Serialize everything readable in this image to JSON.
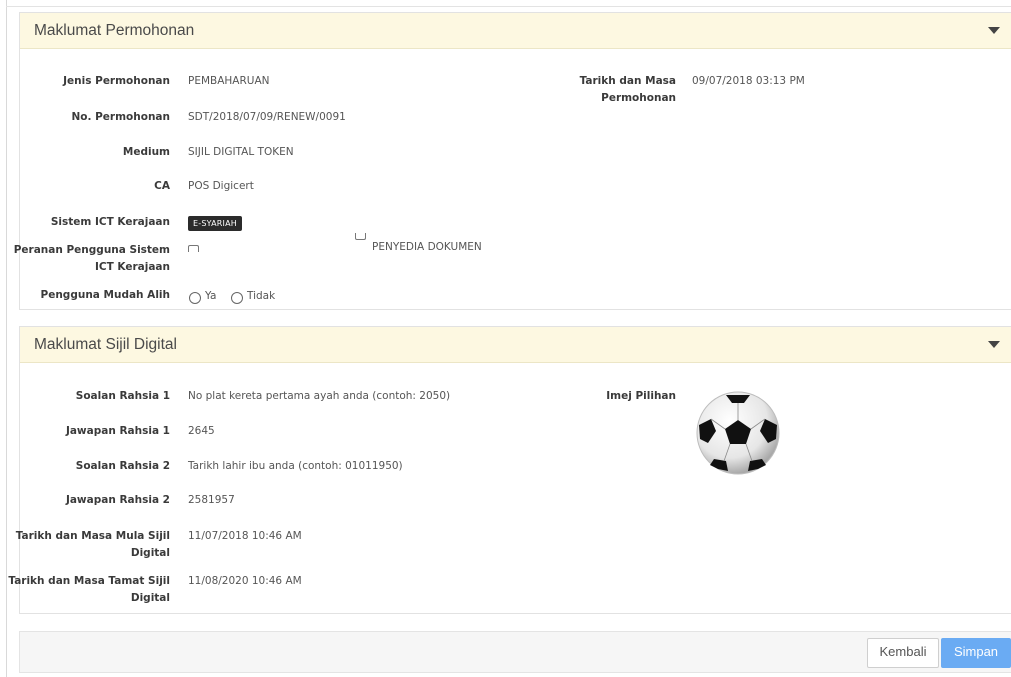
{
  "section1": {
    "title": "Maklumat Permohonan",
    "fields": {
      "jenis_label": "Jenis Permohonan",
      "jenis_value": "PEMBAHARUAN",
      "no_label": "No. Permohonan",
      "no_value": "SDT/2018/07/09/RENEW/0091",
      "medium_label": "Medium",
      "medium_value": "SIJIL DIGITAL TOKEN",
      "ca_label": "CA",
      "ca_value": "POS Digicert",
      "sistem_label": "Sistem ICT Kerajaan",
      "sistem_badge": "E-SYARIAH",
      "peranan_label_line1": "Peranan Pengguna Sistem",
      "peranan_label_line2": "ICT Kerajaan",
      "peranan_option": "PENYEDIA DOKUMEN",
      "mudah_alih_label": "Pengguna Mudah Alih",
      "mudah_alih_yes": "Ya",
      "mudah_alih_no": "Tidak",
      "tarikh_label_line1": "Tarikh dan Masa",
      "tarikh_label_line2": "Permohonan",
      "tarikh_value": "09/07/2018 03:13 PM"
    }
  },
  "section2": {
    "title": "Maklumat Sijil Digital",
    "fields": {
      "soalan1_label": "Soalan Rahsia 1",
      "soalan1_value": "No plat kereta pertama ayah anda (contoh: 2050)",
      "jawapan1_label": "Jawapan Rahsia 1",
      "jawapan1_value": "2645",
      "soalan2_label": "Soalan Rahsia 2",
      "soalan2_value": "Tarikh lahir ibu anda (contoh: 01011950)",
      "jawapan2_label": "Jawapan Rahsia 2",
      "jawapan2_value": "2581957",
      "mula_label_line1": "Tarikh dan Masa Mula Sijil",
      "mula_label_line2": "Digital",
      "mula_value": "11/07/2018 10:46 AM",
      "tamat_label_line1": "Tarikh dan Masa Tamat Sijil",
      "tamat_label_line2": "Digital",
      "tamat_value": "11/08/2020 10:46 AM",
      "imej_label": "Imej Pilihan",
      "imej_icon": "soccer-ball-icon"
    }
  },
  "footer": {
    "back_label": "Kembali",
    "save_label": "Simpan"
  },
  "colors": {
    "panel_header_bg": "#fdf8e1",
    "save_button": "#6aabf3",
    "badge_bg": "#2b2b2b"
  }
}
